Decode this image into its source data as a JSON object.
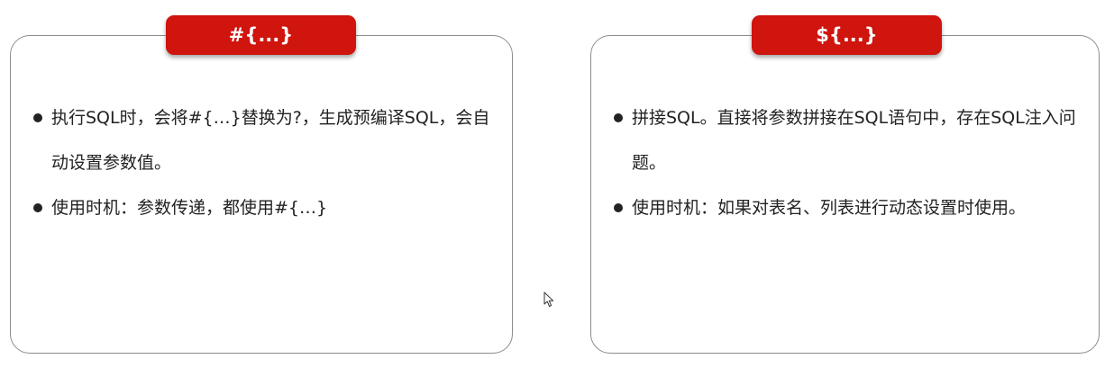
{
  "left_card": {
    "tag": "#{...}",
    "bullets": [
      "执行SQL时，会将#{…}替换为?，生成预编译SQL，会自动设置参数值。",
      "使用时机：参数传递，都使用#{…}"
    ]
  },
  "right_card": {
    "tag": "${...}",
    "bullets": [
      "拼接SQL。直接将参数拼接在SQL语句中，存在SQL注入问题。",
      "使用时机：如果对表名、列表进行动态设置时使用。"
    ]
  },
  "colors": {
    "tag_background": "#d0140e",
    "tag_text": "#ffffff",
    "card_border": "#8c8c8c",
    "body_text": "#222222"
  },
  "icons": {
    "cursor": "mouse-pointer-icon"
  }
}
